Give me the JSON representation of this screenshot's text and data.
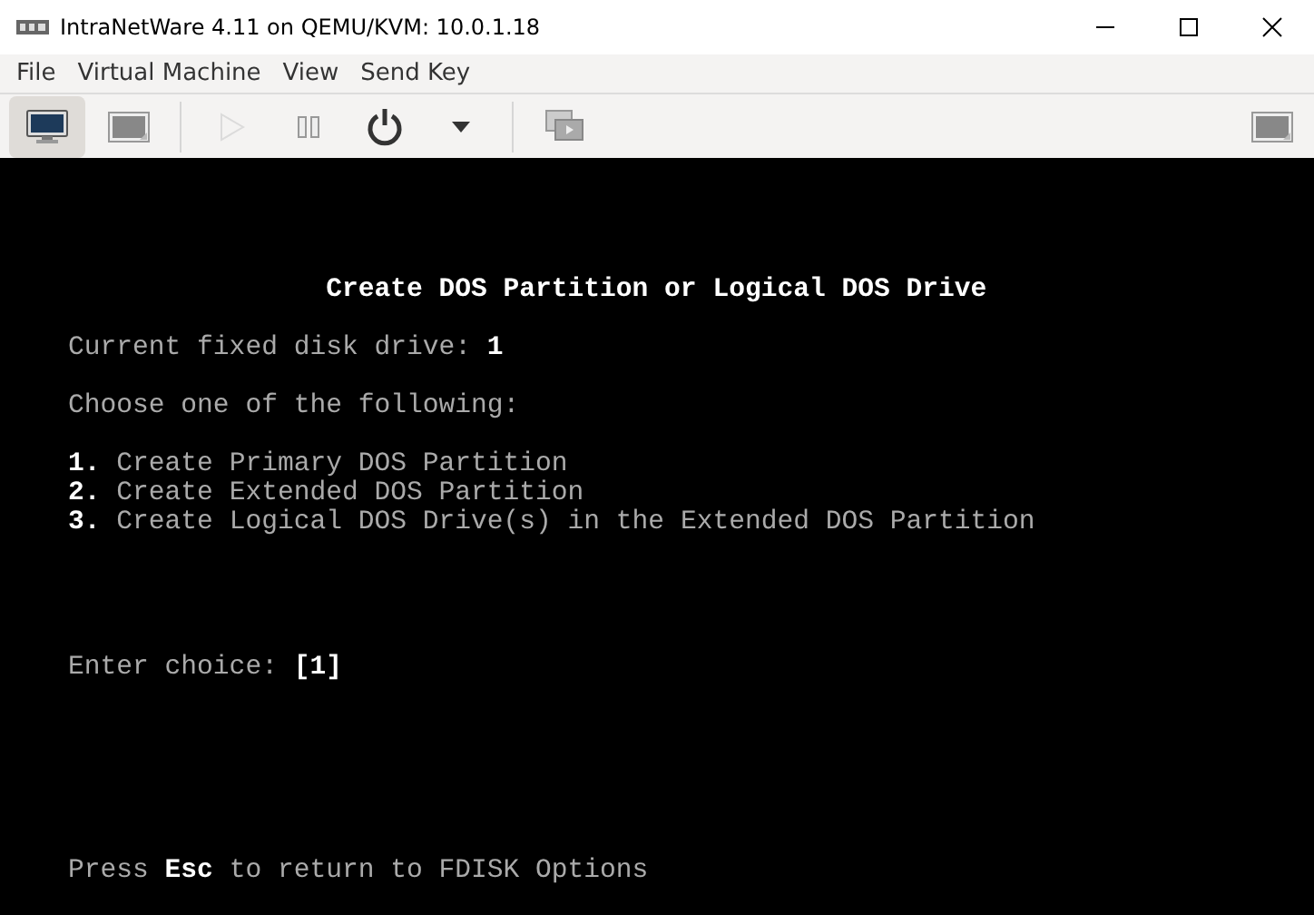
{
  "window": {
    "title": "IntraNetWare 4.11 on QEMU/KVM: 10.0.1.18"
  },
  "menu": [
    "File",
    "Virtual Machine",
    "View",
    "Send Key"
  ],
  "toolbar": [
    {
      "kind": "console",
      "selected": true,
      "disabled": false
    },
    {
      "kind": "details",
      "selected": false,
      "disabled": false
    },
    {
      "kind": "run",
      "selected": false,
      "disabled": true
    },
    {
      "kind": "pause",
      "selected": false,
      "disabled": false
    },
    {
      "kind": "power",
      "selected": false,
      "disabled": false
    },
    {
      "kind": "dropdown",
      "selected": false,
      "disabled": false
    },
    {
      "kind": "snapshots",
      "selected": false,
      "disabled": false
    },
    {
      "kind": "fullscreen",
      "selected": false,
      "disabled": false
    }
  ],
  "console": {
    "lines": [
      {
        "kind": "title",
        "text": "Create DOS Partition or Logical DOS Drive"
      },
      {
        "kind": "info",
        "text": "Current fixed disk drive: **1**"
      },
      {
        "kind": "info",
        "text": "Choose one of the following:"
      },
      {
        "kind": "option",
        "number": "1.",
        "text": "Create Primary DOS Partition"
      },
      {
        "kind": "option",
        "number": "2.",
        "text": "Create Extended DOS Partition"
      },
      {
        "kind": "option",
        "number": "3.",
        "text": "Create Logical DOS Drive(s) in the Extended DOS Partition"
      },
      {
        "kind": "prompt",
        "text": "Enter choice: **[1]**"
      },
      {
        "kind": "footer",
        "text": "Press **Esc** to return to FDISK Options"
      }
    ]
  }
}
